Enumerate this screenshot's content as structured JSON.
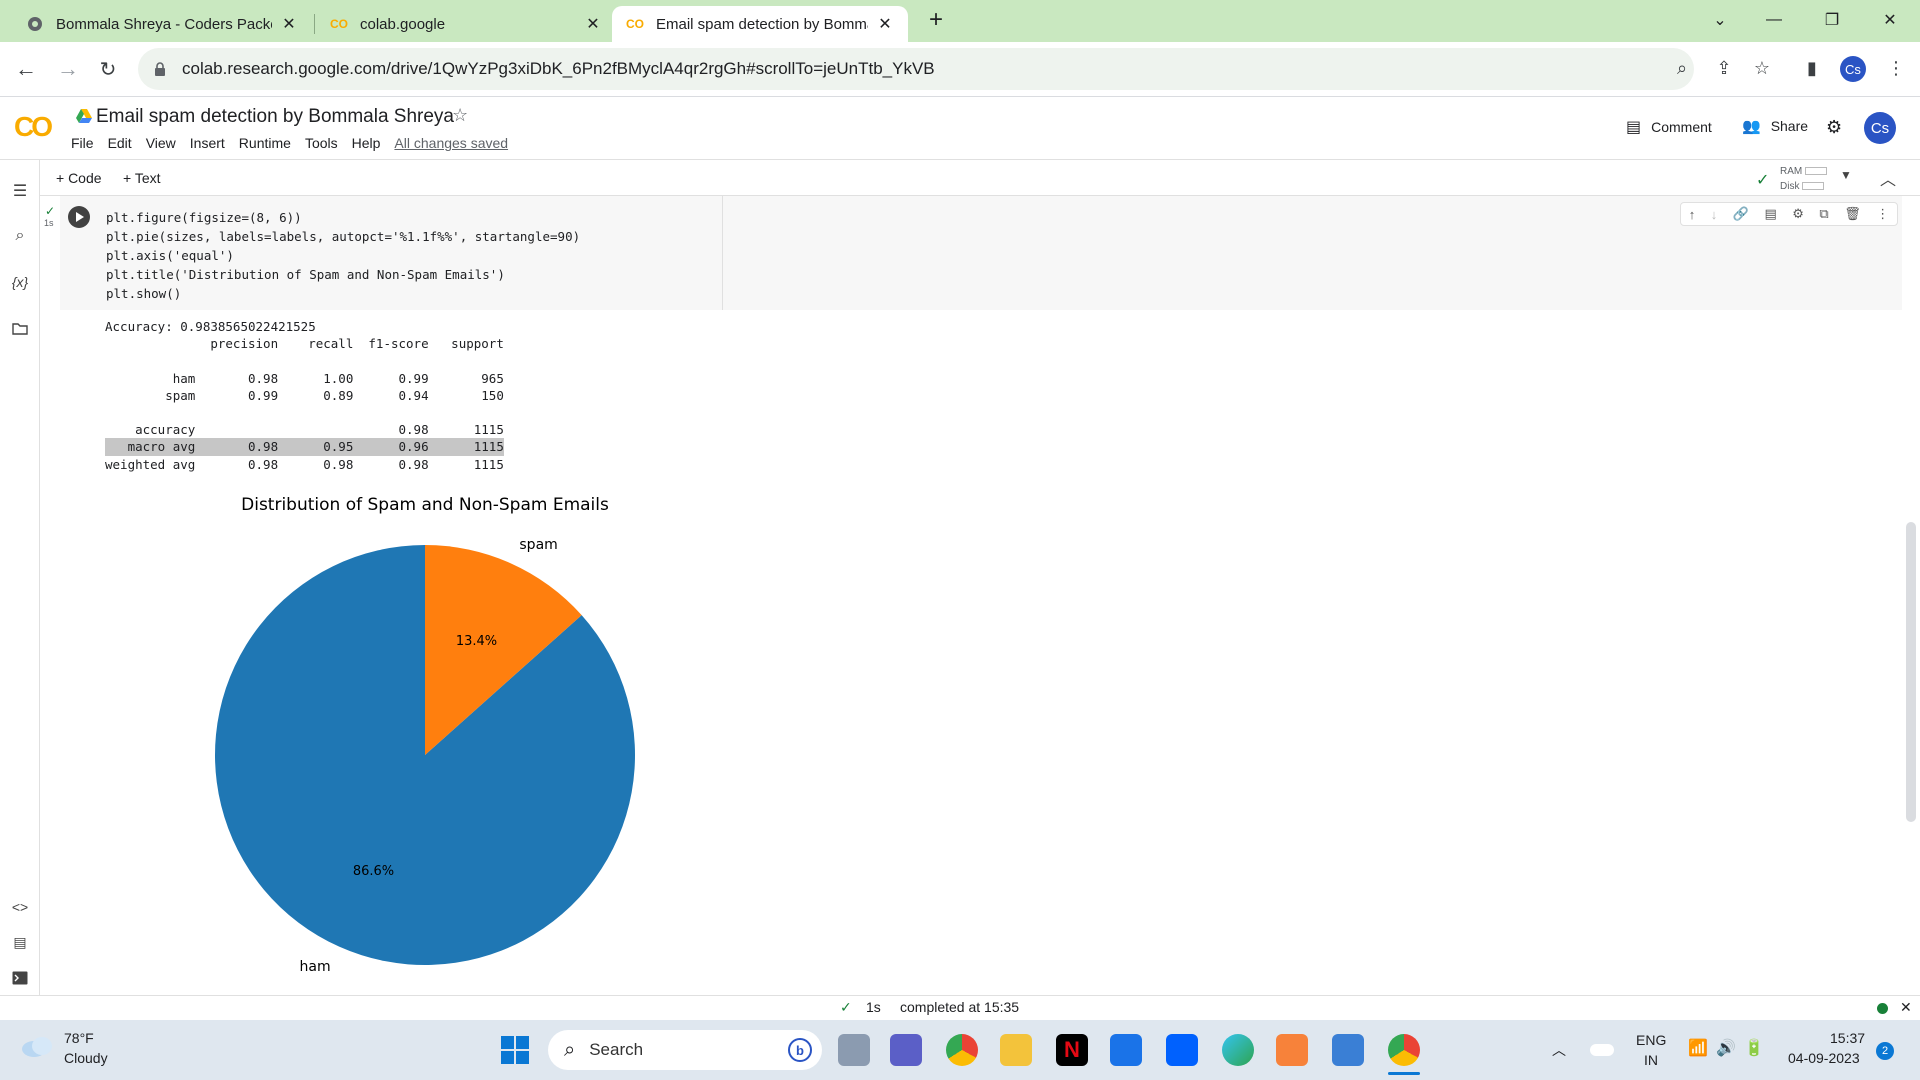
{
  "browser": {
    "tabs": [
      {
        "title": "Bommala Shreya - Coders Packet"
      },
      {
        "title": "colab.google"
      },
      {
        "title": "Email spam detection by Bommala"
      }
    ],
    "url": "colab.research.google.com/drive/1QwYzPg3xiDbK_6Pn2fBMyclA4qr2rgGh#scrollTo=jeUnTtb_YkVB",
    "profile_initials": "Cs"
  },
  "colab": {
    "logo": "CO",
    "title": "Email spam detection by Bommala Shreya",
    "menu": [
      "File",
      "Edit",
      "View",
      "Insert",
      "Runtime",
      "Tools",
      "Help"
    ],
    "saved_status": "All changes saved",
    "comment_label": "Comment",
    "share_label": "Share",
    "add_code": "+ Code",
    "add_text": "+ Text",
    "ram_label": "RAM",
    "disk_label": "Disk",
    "exec_time": "1s"
  },
  "code_lines": [
    "plt.figure(figsize=(8, 6))",
    "plt.pie(sizes, labels=labels, autopct='%1.1f%%', startangle=90)",
    "plt.axis('equal')",
    "plt.title('Distribution of Spam and Non-Spam Emails')",
    "plt.show()"
  ],
  "output": {
    "accuracy_line": "Accuracy: 0.9838565022421525",
    "report": [
      "              precision    recall  f1-score   support",
      "",
      "         ham       0.98      1.00      0.99       965",
      "        spam       0.99      0.89      0.94       150",
      "",
      "    accuracy                           0.98      1115",
      "   macro avg       0.98      0.95      0.96      1115",
      "weighted avg       0.98      0.98      0.98      1115"
    ]
  },
  "chart_data": {
    "type": "pie",
    "title": "Distribution of Spam and Non-Spam Emails",
    "labels": [
      "ham",
      "spam"
    ],
    "values": [
      86.6,
      13.4
    ],
    "autopct": [
      "86.6%",
      "13.4%"
    ],
    "colors": [
      "#1f77b4",
      "#ff7f0e"
    ],
    "startangle": 90
  },
  "status": {
    "check": "✓",
    "duration": "1s",
    "completed": "completed at 15:35"
  },
  "taskbar": {
    "weather_temp": "78°F",
    "weather_desc": "Cloudy",
    "search_placeholder": "Search",
    "lang_top": "ENG",
    "lang_bottom": "IN",
    "time": "15:37",
    "date": "04-09-2023",
    "notif_count": "2"
  }
}
